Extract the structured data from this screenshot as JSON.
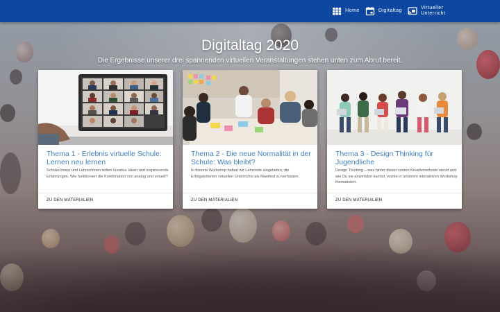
{
  "nav": {
    "items": [
      {
        "label": "Home",
        "icon": "grid-icon"
      },
      {
        "label": "Digitaltag",
        "icon": "calendar-icon"
      },
      {
        "label": "Virtueller Unterricht",
        "icon": "cast-icon"
      }
    ]
  },
  "hero": {
    "title": "Digitaltag 2020",
    "subtitle": "Die Ergebnisse unserer drei spannenden virtuellen Veranstaltungen stehen unten zum Abruf bereit."
  },
  "cards": [
    {
      "title": "Thema 1 - Erlebnis virtuelle Schule: Lernen neu lernen",
      "text": "Schüler/innen und Lehrer/innen teilten kreative Ideen und inspirierende Erfahrungen. Wie funktioniert die Kombination von analog und virtuell?",
      "link": "ZU DEN MATERIALIEN",
      "image": "video-conference-laptop"
    },
    {
      "title": "Thema 2 - Die neue Normalität in der Schule: Was bleibt?",
      "text": "In diesem Workshop haben wir Lehrende eingeladen, die Erfolgskriterien virtuellen Unterrichts als Manifest zu verfassen.",
      "link": "ZU DEN MATERIALIEN",
      "image": "workshop-group-table"
    },
    {
      "title": "Thema 3 - Design Thinking für Jugendliche",
      "text": "Design Thinking – was hinter dieser coolen Kreativmethode steckt und wie Du sie anwenden kannst, wurde in unserem interaktiven Workshop thematisiert.",
      "link": "ZU DEN MATERIALIEN",
      "image": "people-sitting-with-laptops"
    }
  ],
  "colors": {
    "topbar": "#0d47a1",
    "card_title": "#3f7fbf"
  }
}
